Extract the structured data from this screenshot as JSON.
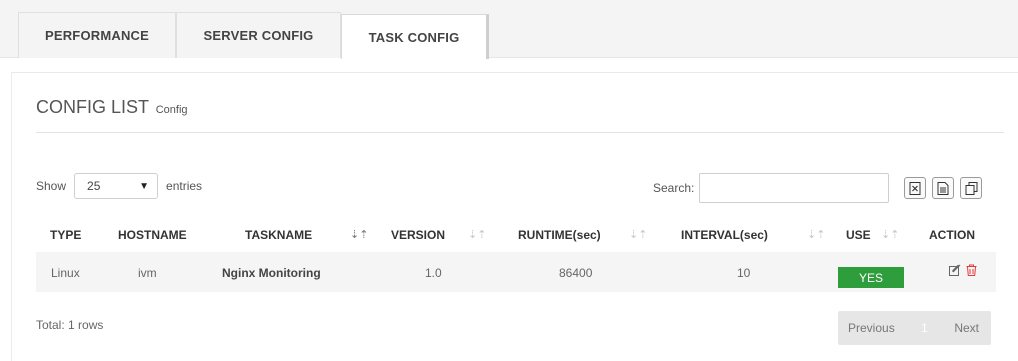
{
  "tabs": [
    {
      "label": "PERFORMANCE"
    },
    {
      "label": "SERVER CONFIG"
    },
    {
      "label": "TASK CONFIG"
    }
  ],
  "panel": {
    "title": "CONFIG LIST",
    "subtitle": "Config"
  },
  "controls": {
    "show_label": "Show",
    "entries_value": "25",
    "entries_label": "entries",
    "search_label": "Search:",
    "search_value": ""
  },
  "table": {
    "headers": [
      "TYPE",
      "HOSTNAME",
      "TASKNAME",
      "VERSION",
      "RUNTIME(sec)",
      "INTERVAL(sec)",
      "USE",
      "ACTION"
    ],
    "rows": [
      {
        "type": "Linux",
        "hostname": "ivm",
        "taskname": "Nginx Monitoring",
        "version": "1.0",
        "runtime": "86400",
        "interval": "10",
        "use": "YES"
      }
    ]
  },
  "footer": {
    "total": "Total: 1 rows",
    "previous": "Previous",
    "page": "1",
    "next": "Next"
  },
  "colors": {
    "use_badge": "#2e9e3d",
    "delete_icon": "#e23b3b"
  },
  "icons": [
    "excel-export-icon",
    "csv-export-icon",
    "copy-icon",
    "edit-icon",
    "trash-icon",
    "chevron-down-icon",
    "sort-icon"
  ]
}
